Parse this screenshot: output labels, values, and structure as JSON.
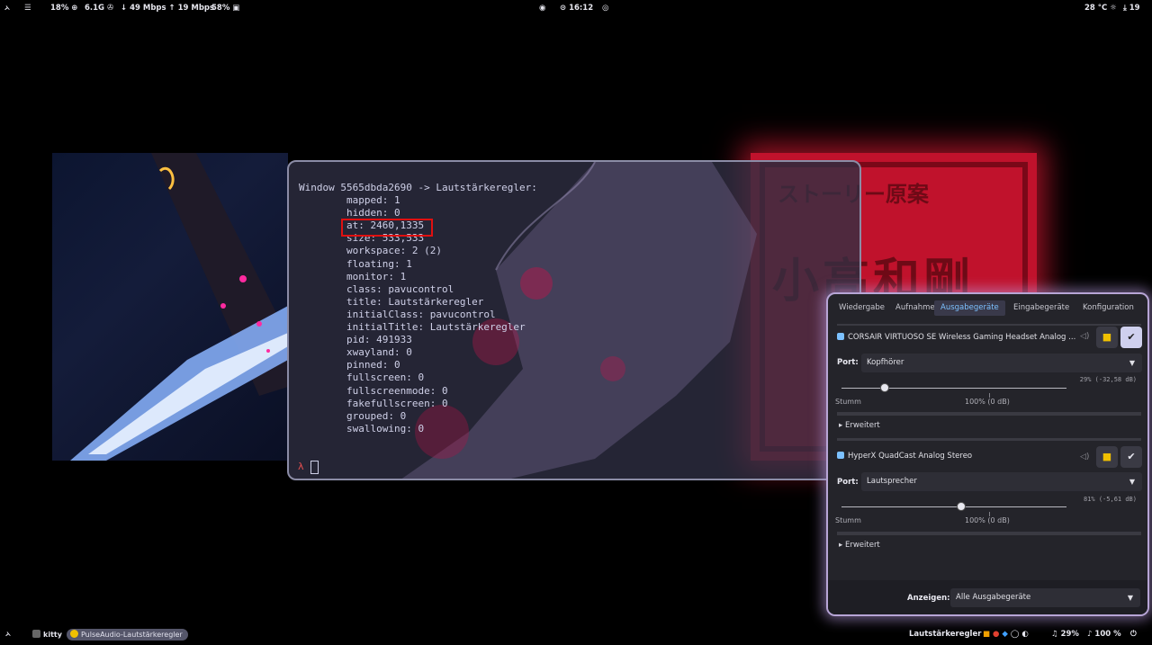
{
  "topbar": {
    "left": [
      "ᨂ",
      "☰",
      "18% ⊕",
      "6.1G ✇",
      "↓ 49 Mbps ↑ 19 Mbps",
      "58% ▣"
    ],
    "center_icon": "eye-slash-icon",
    "clock": "⊙ 16:12",
    "center_right_icon": "record-icon",
    "temp": "28 °C ☼",
    "updates": "⤓ 19"
  },
  "terminal": {
    "header": "Window 5565dbda2690 -> Lautstärkeregler:",
    "lines": [
      "mapped: 1",
      "hidden: 0",
      "at: 2460,1335",
      "size: 533,533",
      "workspace: 2 (2)",
      "floating: 1",
      "monitor: 1",
      "class: pavucontrol",
      "title: Lautstärkeregler",
      "initialClass: pavucontrol",
      "initialTitle: Lautstärkeregler",
      "pid: 491933",
      "xwayland: 0",
      "pinned: 0",
      "fullscreen: 0",
      "fullscreenmode: 0",
      "fakefullscreen: 0",
      "grouped: 0",
      "swallowing: 0"
    ],
    "prompt": "λ"
  },
  "wallpaper_right": {
    "text_top": "ストーリー原案",
    "text_mid": "小高和剛"
  },
  "pavu": {
    "tabs": [
      "Wiedergabe",
      "Aufnahme",
      "Ausgabegeräte",
      "Eingabegeräte",
      "Konfiguration"
    ],
    "active_tab": 2,
    "devices": [
      {
        "name": "CORSAIR VIRTUOSO SE Wireless Gaming Headset Analog ...",
        "port_label": "Port:",
        "port": "Kopfhörer",
        "volume_text": "29% (-32,58 dB)",
        "volume": 0.29,
        "mute_label": "Stumm",
        "base_label": "100% (0 dB)",
        "advanced": "▸ Erweitert",
        "default_active": true
      },
      {
        "name": "HyperX QuadCast Analog Stereo",
        "port_label": "Port:",
        "port": "Lautsprecher",
        "volume_text": "81% (-5,61 dB)",
        "volume": 0.81,
        "mute_label": "Stumm",
        "base_label": "100% (0 dB)",
        "advanced": "▸ Erweitert",
        "default_active": false
      }
    ],
    "show_label": "Anzeigen:",
    "show_value": "Alle Ausgabegeräte"
  },
  "bottombar": {
    "launcher": "ᨂ",
    "kitty": "kitty",
    "pavu_task": "PulseAudio-Lautstärkeregler",
    "window_title": "Lautstärkeregler",
    "volume": "29%",
    "mic": "100 %",
    "power_icon": "power-icon"
  },
  "colors": {
    "accent_blue": "#7cc1ff",
    "highlight_red": "#e01010",
    "border_lilac": "#b7a5d6"
  }
}
